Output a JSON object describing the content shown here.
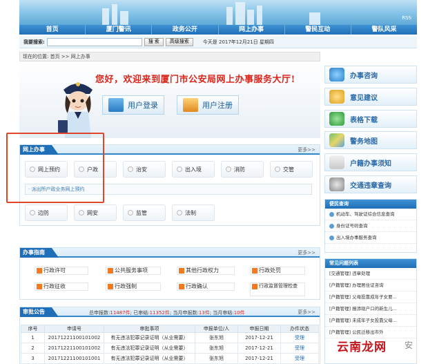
{
  "header": {
    "rss": "RSS"
  },
  "nav": [
    "首页",
    "厦门警讯",
    "政务公开",
    "网上办事",
    "警民互动",
    "警队风采"
  ],
  "search": {
    "label": "我要搜索:",
    "value": "",
    "search_btn": "搜 索",
    "advanced_btn": "高级搜索",
    "date_text": "今天是 2017年12月21日  星期四"
  },
  "breadcrumb": "现在的位置: 首页 >> 网上办事",
  "hero": {
    "welcome": "您好，欢迎来到厦门市公安局网上办事服务大厅!",
    "login": "用户登录",
    "register": "用户注册"
  },
  "online": {
    "title": "网上办事",
    "more": "更多>>",
    "row1": [
      "网上预约",
      "户政",
      "治安",
      "出入境",
      "消防",
      "交管"
    ],
    "sublink": "· 派出所户政业务网上预约",
    "row2": [
      "边防",
      "网安",
      "监管",
      "法制"
    ]
  },
  "guide": {
    "title": "办事指南",
    "more": "更多>>",
    "items": [
      "行政许可",
      "公共服务事项",
      "其他行政权力",
      "行政处罚",
      "行政征收",
      "行政强制",
      "行政确认",
      "行政监督管理检查"
    ]
  },
  "approval": {
    "title": "审批公告",
    "more": "更多>>",
    "stats": {
      "p1": "总申报数:",
      "total": "11487件",
      "p2": "; 已审结:",
      "done": "11352件",
      "p3": "; 当月申报数:",
      "month": "13件",
      "p4": "; 当月审结:",
      "month_done": "10件"
    },
    "columns": [
      "序号",
      "申请号",
      "审批事项",
      "申报单位/人",
      "申报日期",
      "办件状态"
    ],
    "rows": [
      [
        "1",
        "20171221100101002",
        "有无违法犯罪记录证明（从业需要）",
        "张东旭",
        "2017-12-21",
        "受理"
      ],
      [
        "2",
        "20171221100101002",
        "有无违法犯罪记录证明（从业需要）",
        "张东旭",
        "2017-12-21",
        "受理"
      ],
      [
        "3",
        "20171221100101001",
        "有无违法犯罪记录证明（从业需要）",
        "张东旭",
        "2017-12-21",
        "受理"
      ]
    ]
  },
  "right": {
    "buttons": [
      "办事咨询",
      "意见建议",
      "表格下载",
      "警务地图",
      "户籍办事须知",
      "交通违章查询"
    ],
    "cert_query": {
      "title": "便民查询",
      "items": [
        "机动车、驾驶证综合信息查询",
        "身份证号码查询",
        "出入境办事服务查询"
      ]
    },
    "faq": {
      "title": "常见问题列表",
      "items": [
        "[交通管理] 违章处理",
        "[户籍管理] 办理居住证咨询",
        "[户籍管理] 父母投靠成年子女要...",
        "[户籍管理] 报添现户口的新生儿...",
        "[户籍管理] 未成年子女投靠父母...",
        "[户籍管理] 公民迁移出市外"
      ]
    }
  },
  "watermark": {
    "text": "云南龙网",
    "suffix": "安"
  }
}
